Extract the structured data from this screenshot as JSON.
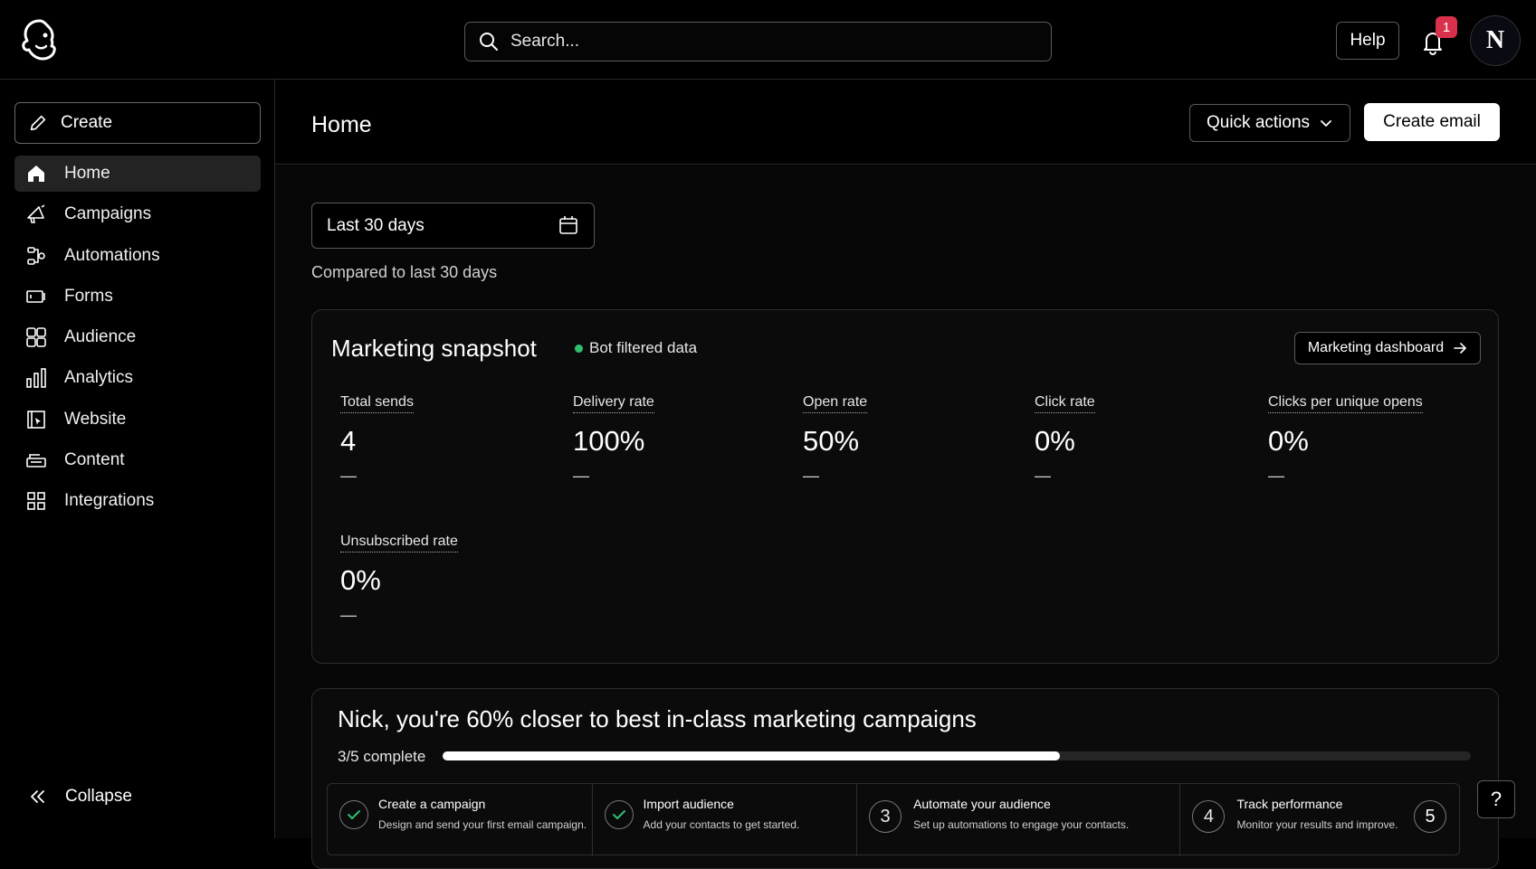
{
  "header": {
    "search_placeholder": "Search...",
    "help_label": "Help",
    "notification_count": "1",
    "avatar_initial": "N"
  },
  "sidebar": {
    "create_label": "Create",
    "items": [
      {
        "label": "Home",
        "icon": "home-icon",
        "active": true
      },
      {
        "label": "Campaigns",
        "icon": "megaphone-icon"
      },
      {
        "label": "Automations",
        "icon": "automation-icon"
      },
      {
        "label": "Forms",
        "icon": "form-icon"
      },
      {
        "label": "Audience",
        "icon": "audience-icon"
      },
      {
        "label": "Analytics",
        "icon": "bar-chart-icon"
      },
      {
        "label": "Website",
        "icon": "website-icon"
      },
      {
        "label": "Content",
        "icon": "content-icon"
      },
      {
        "label": "Integrations",
        "icon": "grid-icon"
      }
    ],
    "collapse_label": "Collapse"
  },
  "main": {
    "title": "Home",
    "quick_actions_label": "Quick actions",
    "create_email_label": "Create email",
    "date_range": "Last 30 days",
    "compared_text": "Compared to last 30 days"
  },
  "snapshot": {
    "title": "Marketing snapshot",
    "bot_filtered": "Bot filtered data",
    "dashboard_button": "Marketing dashboard",
    "metrics": [
      {
        "label": "Total sends",
        "value": "4",
        "change": "—"
      },
      {
        "label": "Delivery rate",
        "value": "100%",
        "change": "—"
      },
      {
        "label": "Open rate",
        "value": "50%",
        "change": "—"
      },
      {
        "label": "Click rate",
        "value": "0%",
        "change": "—"
      },
      {
        "label": "Clicks per unique opens",
        "value": "0%",
        "change": "—"
      },
      {
        "label": "Unsubscribed rate",
        "value": "0%",
        "change": "—"
      }
    ]
  },
  "progress": {
    "title": "Nick, you're 60% closer to best in-class marketing campaigns",
    "count_text": "3/5 complete",
    "fraction": 0.6,
    "steps": [
      {
        "title": "Create a campaign",
        "desc": "Design and send your first email campaign.",
        "done": true
      },
      {
        "title": "Import audience",
        "desc": "Add your contacts to get started.",
        "done": true
      },
      {
        "title": "Automate your audience",
        "desc": "Set up automations to engage your contacts.",
        "number": "3"
      },
      {
        "title": "Track performance",
        "desc": "Monitor your results and improve.",
        "number": "4",
        "next": "5"
      }
    ]
  },
  "help_float": "?",
  "colors": {
    "badge": "#d9304b",
    "bot_dot": "#2fbf71",
    "accent": "#ffffff"
  }
}
